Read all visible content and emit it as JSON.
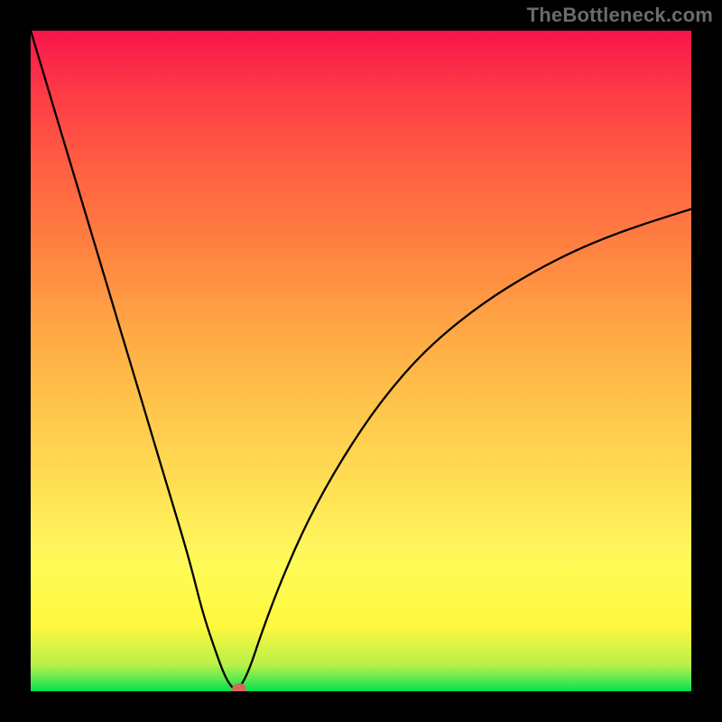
{
  "watermark": "TheBottleneck.com",
  "colors": {
    "frame_border": "#000000",
    "curve": "#000000",
    "marker": "#d46a5f",
    "gradient_top": "#f7144a",
    "gradient_mid": "#ffd24f",
    "gradient_bottom": "#00e053"
  },
  "chart_data": {
    "type": "line",
    "title": "",
    "xlabel": "",
    "ylabel": "",
    "xlim": [
      0,
      100
    ],
    "ylim": [
      0,
      100
    ],
    "grid": false,
    "series": [
      {
        "name": "bottleneck-curve",
        "x": [
          0,
          3,
          6,
          9,
          12,
          15,
          18,
          21,
          24,
          26,
          28,
          29.5,
          30.7,
          31.5,
          33,
          35,
          38,
          42,
          47,
          53,
          60,
          68,
          76,
          84,
          92,
          100
        ],
        "y": [
          100,
          90,
          80,
          70,
          60,
          50,
          40,
          30,
          20,
          12,
          6,
          2,
          0.3,
          0.3,
          3,
          9,
          17,
          26,
          35,
          44,
          52,
          58.5,
          63.5,
          67.5,
          70.5,
          73
        ]
      }
    ],
    "marker": {
      "x": 31.5,
      "y": 0.3
    },
    "gradient_stops": [
      {
        "pos": 0.0,
        "color": "#00e053"
      },
      {
        "pos": 0.015,
        "color": "#4de84f"
      },
      {
        "pos": 0.04,
        "color": "#b9f04a"
      },
      {
        "pos": 0.1,
        "color": "#fff83f"
      },
      {
        "pos": 0.19,
        "color": "#fffb56"
      },
      {
        "pos": 0.22,
        "color": "#fff45c"
      },
      {
        "pos": 0.3,
        "color": "#ffe254"
      },
      {
        "pos": 0.37,
        "color": "#ffd24f"
      },
      {
        "pos": 0.44,
        "color": "#ffc24b"
      },
      {
        "pos": 0.5,
        "color": "#ffb447"
      },
      {
        "pos": 0.56,
        "color": "#ffa445"
      },
      {
        "pos": 0.62,
        "color": "#ff9143"
      },
      {
        "pos": 0.68,
        "color": "#ff7f41"
      },
      {
        "pos": 0.74,
        "color": "#ff6e41"
      },
      {
        "pos": 0.8,
        "color": "#ff5d42"
      },
      {
        "pos": 0.86,
        "color": "#ff4a45"
      },
      {
        "pos": 0.92,
        "color": "#fd3547"
      },
      {
        "pos": 0.97,
        "color": "#fa2149"
      },
      {
        "pos": 1.0,
        "color": "#f7144a"
      }
    ]
  }
}
